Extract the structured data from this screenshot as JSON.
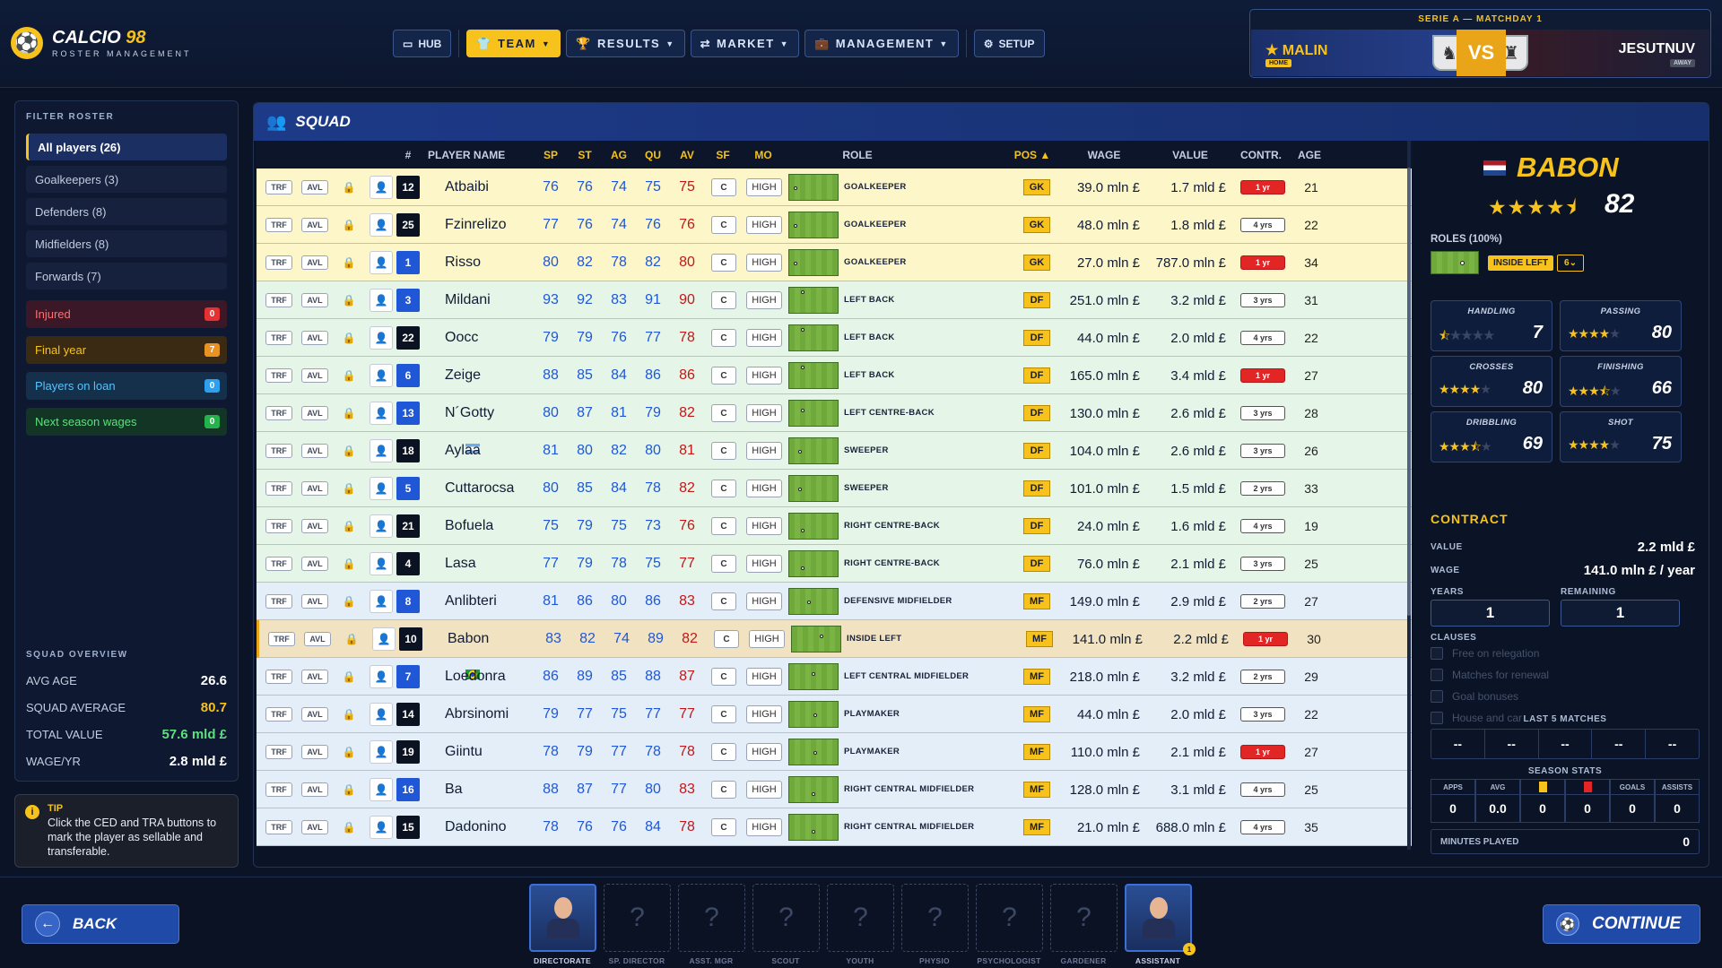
{
  "app": {
    "name": "CALCIO",
    "name_accent": "98",
    "subtitle": "ROSTER MANAGEMENT"
  },
  "nav": [
    {
      "label": "HUB",
      "icon": "monitor-icon",
      "active": false,
      "dropdown": false
    },
    {
      "label": "TEAM",
      "icon": "team-icon",
      "active": true,
      "dropdown": true
    },
    {
      "label": "RESULTS",
      "icon": "trophy-icon",
      "active": false,
      "dropdown": true
    },
    {
      "label": "MARKET",
      "icon": "transfer-icon",
      "active": false,
      "dropdown": true
    },
    {
      "label": "MANAGEMENT",
      "icon": "briefcase-icon",
      "active": false,
      "dropdown": true
    },
    {
      "label": "SETUP",
      "icon": "gear-icon",
      "active": false,
      "dropdown": false
    }
  ],
  "match": {
    "caption": "SERIE A — MATCHDAY 1",
    "home": "MALIN",
    "home_tag": "HOME",
    "away": "JESUTNUV",
    "away_tag": "AWAY",
    "vs": "VS"
  },
  "filters": {
    "header": "FILTER ROSTER",
    "items": [
      "All players (26)",
      "Goalkeepers (3)",
      "Defenders (8)",
      "Midfielders (8)",
      "Forwards (7)"
    ],
    "flags": [
      {
        "label": "Injured",
        "count": "0"
      },
      {
        "label": "Final year",
        "count": "7"
      },
      {
        "label": "Players on loan",
        "count": "0"
      },
      {
        "label": "Next season wages",
        "count": "0"
      }
    ]
  },
  "overview": {
    "header": "SQUAD OVERVIEW",
    "rows": [
      {
        "label": "AVG AGE",
        "value": "26.6"
      },
      {
        "label": "SQUAD AVERAGE",
        "value": "80.7"
      },
      {
        "label": "TOTAL VALUE",
        "value": "57.6 mld £"
      },
      {
        "label": "WAGE/YR",
        "value": "2.8 mld £"
      }
    ]
  },
  "tip": {
    "title": "TIP",
    "text": "Click the CED and TRA buttons to mark the player as sellable and transferable."
  },
  "squad": {
    "title": "SQUAD",
    "columns": {
      "num": "#",
      "name": "PLAYER NAME",
      "sp": "SP",
      "st": "ST",
      "ag": "AG",
      "qu": "QU",
      "av": "AV",
      "sf": "SF",
      "mo": "MO",
      "role": "ROLE",
      "pos": "POS ▲",
      "wage": "WAGE",
      "value": "VALUE",
      "contr": "CONTR.",
      "age": "AGE"
    },
    "labels": {
      "trf": "TRF",
      "avl": "AVL"
    },
    "players": [
      {
        "num": "12",
        "numColor": "black",
        "name": "Atbaibi",
        "sp": "76",
        "st": "76",
        "ag": "74",
        "qu": "75",
        "av": "75",
        "sf": "C",
        "mo": "HIGH",
        "role": "GOALKEEPER",
        "pos": "GK",
        "wage": "39.0 mln £",
        "value": "1.7 mld £",
        "contr": "1 yr",
        "contrRed": true,
        "age": "21",
        "group": "gk",
        "dot": [
          0.1,
          0.5
        ]
      },
      {
        "num": "25",
        "numColor": "black",
        "name": "Fzinrelizo",
        "sp": "77",
        "st": "76",
        "ag": "74",
        "qu": "76",
        "av": "76",
        "sf": "C",
        "mo": "HIGH",
        "role": "GOALKEEPER",
        "pos": "GK",
        "wage": "48.0 mln £",
        "value": "1.8 mld £",
        "contr": "4 yrs",
        "contrRed": false,
        "age": "22",
        "group": "gk",
        "dot": [
          0.1,
          0.5
        ]
      },
      {
        "num": "1",
        "numColor": "blue",
        "name": "Risso",
        "sp": "80",
        "st": "82",
        "ag": "78",
        "qu": "82",
        "av": "80",
        "sf": "C",
        "mo": "HIGH",
        "role": "GOALKEEPER",
        "pos": "GK",
        "wage": "27.0 mln £",
        "value": "787.0 mln £",
        "contr": "1 yr",
        "contrRed": true,
        "age": "34",
        "group": "gk",
        "dot": [
          0.1,
          0.5
        ]
      },
      {
        "num": "3",
        "numColor": "blue",
        "name": "Mildani",
        "sp": "93",
        "st": "92",
        "ag": "83",
        "qu": "91",
        "av": "90",
        "sf": "C",
        "mo": "HIGH",
        "role": "LEFT BACK",
        "pos": "DF",
        "wage": "251.0 mln £",
        "value": "3.2 mld £",
        "contr": "3 yrs",
        "contrRed": false,
        "age": "31",
        "group": "df",
        "dot": [
          0.25,
          0.12
        ]
      },
      {
        "num": "22",
        "numColor": "black",
        "name": "Oocc",
        "sp": "79",
        "st": "79",
        "ag": "76",
        "qu": "77",
        "av": "78",
        "sf": "C",
        "mo": "HIGH",
        "role": "LEFT BACK",
        "pos": "DF",
        "wage": "44.0 mln £",
        "value": "2.0 mld £",
        "contr": "4 yrs",
        "contrRed": false,
        "age": "22",
        "group": "df",
        "dot": [
          0.25,
          0.12
        ]
      },
      {
        "num": "6",
        "numColor": "blue",
        "name": "Zeige",
        "sp": "88",
        "st": "85",
        "ag": "84",
        "qu": "86",
        "av": "86",
        "sf": "C",
        "mo": "HIGH",
        "role": "LEFT BACK",
        "pos": "DF",
        "wage": "165.0 mln £",
        "value": "3.4 mld £",
        "contr": "1 yr",
        "contrRed": true,
        "age": "27",
        "group": "df",
        "dot": [
          0.25,
          0.12
        ]
      },
      {
        "num": "13",
        "numColor": "blue",
        "name": "N´Gotty",
        "sp": "80",
        "st": "87",
        "ag": "81",
        "qu": "79",
        "av": "82",
        "sf": "C",
        "mo": "HIGH",
        "role": "LEFT CENTRE-BACK",
        "pos": "DF",
        "wage": "130.0 mln £",
        "value": "2.6 mld £",
        "contr": "3 yrs",
        "contrRed": false,
        "age": "28",
        "group": "df",
        "dot": [
          0.25,
          0.35
        ]
      },
      {
        "num": "18",
        "numColor": "black",
        "name": "Aylaa",
        "sp": "81",
        "st": "80",
        "ag": "82",
        "qu": "80",
        "av": "81",
        "sf": "C",
        "mo": "HIGH",
        "role": "SWEEPER",
        "pos": "DF",
        "wage": "104.0 mln £",
        "value": "2.6 mld £",
        "contr": "3 yrs",
        "contrRed": false,
        "age": "26",
        "group": "df",
        "dot": [
          0.2,
          0.5
        ],
        "nat": "argentina"
      },
      {
        "num": "5",
        "numColor": "blue",
        "name": "Cuttarocsa",
        "sp": "80",
        "st": "85",
        "ag": "84",
        "qu": "78",
        "av": "82",
        "sf": "C",
        "mo": "HIGH",
        "role": "SWEEPER",
        "pos": "DF",
        "wage": "101.0 mln £",
        "value": "1.5 mld £",
        "contr": "2 yrs",
        "contrRed": false,
        "age": "33",
        "group": "df",
        "dot": [
          0.2,
          0.5
        ]
      },
      {
        "num": "21",
        "numColor": "black",
        "name": "Bofuela",
        "sp": "75",
        "st": "79",
        "ag": "75",
        "qu": "73",
        "av": "76",
        "sf": "C",
        "mo": "HIGH",
        "role": "RIGHT CENTRE-BACK",
        "pos": "DF",
        "wage": "24.0 mln £",
        "value": "1.6 mld £",
        "contr": "4 yrs",
        "contrRed": false,
        "age": "19",
        "group": "df",
        "dot": [
          0.25,
          0.65
        ]
      },
      {
        "num": "4",
        "numColor": "black",
        "name": "Lasa",
        "sp": "77",
        "st": "79",
        "ag": "78",
        "qu": "75",
        "av": "77",
        "sf": "C",
        "mo": "HIGH",
        "role": "RIGHT CENTRE-BACK",
        "pos": "DF",
        "wage": "76.0 mln £",
        "value": "2.1 mld £",
        "contr": "3 yrs",
        "contrRed": false,
        "age": "25",
        "group": "df",
        "dot": [
          0.25,
          0.65
        ]
      },
      {
        "num": "8",
        "numColor": "blue",
        "name": "Anlibteri",
        "sp": "81",
        "st": "86",
        "ag": "80",
        "qu": "86",
        "av": "83",
        "sf": "C",
        "mo": "HIGH",
        "role": "DEFENSIVE MIDFIELDER",
        "pos": "MF",
        "wage": "149.0 mln £",
        "value": "2.9 mld £",
        "contr": "2 yrs",
        "contrRed": false,
        "age": "27",
        "group": "mf",
        "dot": [
          0.38,
          0.5
        ]
      },
      {
        "num": "10",
        "numColor": "black",
        "name": "Babon",
        "sp": "83",
        "st": "82",
        "ag": "74",
        "qu": "89",
        "av": "82",
        "sf": "C",
        "mo": "HIGH",
        "role": "INSIDE LEFT",
        "pos": "MF",
        "wage": "141.0 mln £",
        "value": "2.2 mld £",
        "contr": "1 yr",
        "contrRed": true,
        "age": "30",
        "group": "mf",
        "selected": true,
        "dot": [
          0.6,
          0.35
        ]
      },
      {
        "num": "7",
        "numColor": "blue",
        "name": "Loedonra",
        "sp": "86",
        "st": "89",
        "ag": "85",
        "qu": "88",
        "av": "87",
        "sf": "C",
        "mo": "HIGH",
        "role": "LEFT CENTRAL MIDFIELDER",
        "pos": "MF",
        "wage": "218.0 mln £",
        "value": "3.2 mld £",
        "contr": "2 yrs",
        "contrRed": false,
        "age": "29",
        "group": "mf",
        "dot": [
          0.48,
          0.35
        ],
        "nat": "brazil"
      },
      {
        "num": "14",
        "numColor": "black",
        "name": "Abrsinomi",
        "sp": "79",
        "st": "77",
        "ag": "75",
        "qu": "77",
        "av": "77",
        "sf": "C",
        "mo": "HIGH",
        "role": "PLAYMAKER",
        "pos": "MF",
        "wage": "44.0 mln £",
        "value": "2.0 mld £",
        "contr": "3 yrs",
        "contrRed": false,
        "age": "22",
        "group": "mf",
        "dot": [
          0.52,
          0.5
        ]
      },
      {
        "num": "19",
        "numColor": "black",
        "name": "Giintu",
        "sp": "78",
        "st": "79",
        "ag": "77",
        "qu": "78",
        "av": "78",
        "sf": "C",
        "mo": "HIGH",
        "role": "PLAYMAKER",
        "pos": "MF",
        "wage": "110.0 mln £",
        "value": "2.1 mld £",
        "contr": "1 yr",
        "contrRed": true,
        "age": "27",
        "group": "mf",
        "dot": [
          0.52,
          0.5
        ]
      },
      {
        "num": "16",
        "numColor": "blue",
        "name": "Ba",
        "sp": "88",
        "st": "87",
        "ag": "77",
        "qu": "80",
        "av": "83",
        "sf": "C",
        "mo": "HIGH",
        "role": "RIGHT CENTRAL MIDFIELDER",
        "pos": "MF",
        "wage": "128.0 mln £",
        "value": "3.1 mld £",
        "contr": "4 yrs",
        "contrRed": false,
        "age": "25",
        "group": "mf",
        "dot": [
          0.48,
          0.65
        ]
      },
      {
        "num": "15",
        "numColor": "black",
        "name": "Dadonino",
        "sp": "78",
        "st": "76",
        "ag": "76",
        "qu": "84",
        "av": "78",
        "sf": "C",
        "mo": "HIGH",
        "role": "RIGHT CENTRAL MIDFIELDER",
        "pos": "MF",
        "wage": "21.0 mln £",
        "value": "688.0 mln £",
        "contr": "4 yrs",
        "contrRed": false,
        "age": "35",
        "group": "mf",
        "dot": [
          0.48,
          0.65
        ]
      }
    ]
  },
  "detail": {
    "name": "BABON",
    "overall": "82",
    "stars": 4.5,
    "roles_label": "ROLES (100%)",
    "role_tag": "INSIDE LEFT",
    "role_select": "6",
    "attrs": [
      {
        "name": "HANDLING",
        "value": "7",
        "stars": 0.5
      },
      {
        "name": "PASSING",
        "value": "80",
        "stars": 4
      },
      {
        "name": "CROSSES",
        "value": "80",
        "stars": 4
      },
      {
        "name": "FINISHING",
        "value": "66",
        "stars": 3.5
      },
      {
        "name": "DRIBBLING",
        "value": "69",
        "stars": 3.5
      },
      {
        "name": "SHOT",
        "value": "75",
        "stars": 4
      }
    ],
    "contract_title": "CONTRACT",
    "value_label": "VALUE",
    "value": "2.2 mld £",
    "wage_label": "WAGE",
    "wage": "141.0 mln £ / year",
    "years_label": "YEARS",
    "years": "1",
    "remaining_label": "REMAINING",
    "remaining": "1",
    "clauses_label": "CLAUSES",
    "clauses": [
      "Free on relegation",
      "Matches for renewal",
      "Goal bonuses",
      "House and car"
    ],
    "last5_label": "LAST 5 MATCHES",
    "last5": [
      "--",
      "--",
      "--",
      "--",
      "--"
    ],
    "season_label": "SEASON STATS",
    "season_heads": [
      "APPS",
      "AVG",
      "",
      "",
      "GOALS",
      "ASSISTS"
    ],
    "season_vals": [
      "0",
      "0.0",
      "0",
      "0",
      "0",
      "0"
    ],
    "minutes_label": "MINUTES PLAYED",
    "minutes": "0"
  },
  "footer": {
    "back": "BACK",
    "continue": "CONTINUE",
    "staff": [
      {
        "label": "DIRECTORATE",
        "filled": true,
        "badge": ""
      },
      {
        "label": "SP. DIRECTOR",
        "filled": false
      },
      {
        "label": "ASST. MGR",
        "filled": false
      },
      {
        "label": "SCOUT",
        "filled": false
      },
      {
        "label": "YOUTH",
        "filled": false
      },
      {
        "label": "PHYSIO",
        "filled": false
      },
      {
        "label": "PSYCHOLOGIST",
        "filled": false
      },
      {
        "label": "GARDENER",
        "filled": false
      },
      {
        "label": "ASSISTANT",
        "filled": true,
        "badge": "1"
      }
    ],
    "unknown": "?"
  },
  "colors": {
    "accent": "#f6c21b",
    "primary": "#1f4aa8",
    "danger": "#e22626",
    "stat_blue": "#1f57d6",
    "stat_red": "#c01818"
  }
}
